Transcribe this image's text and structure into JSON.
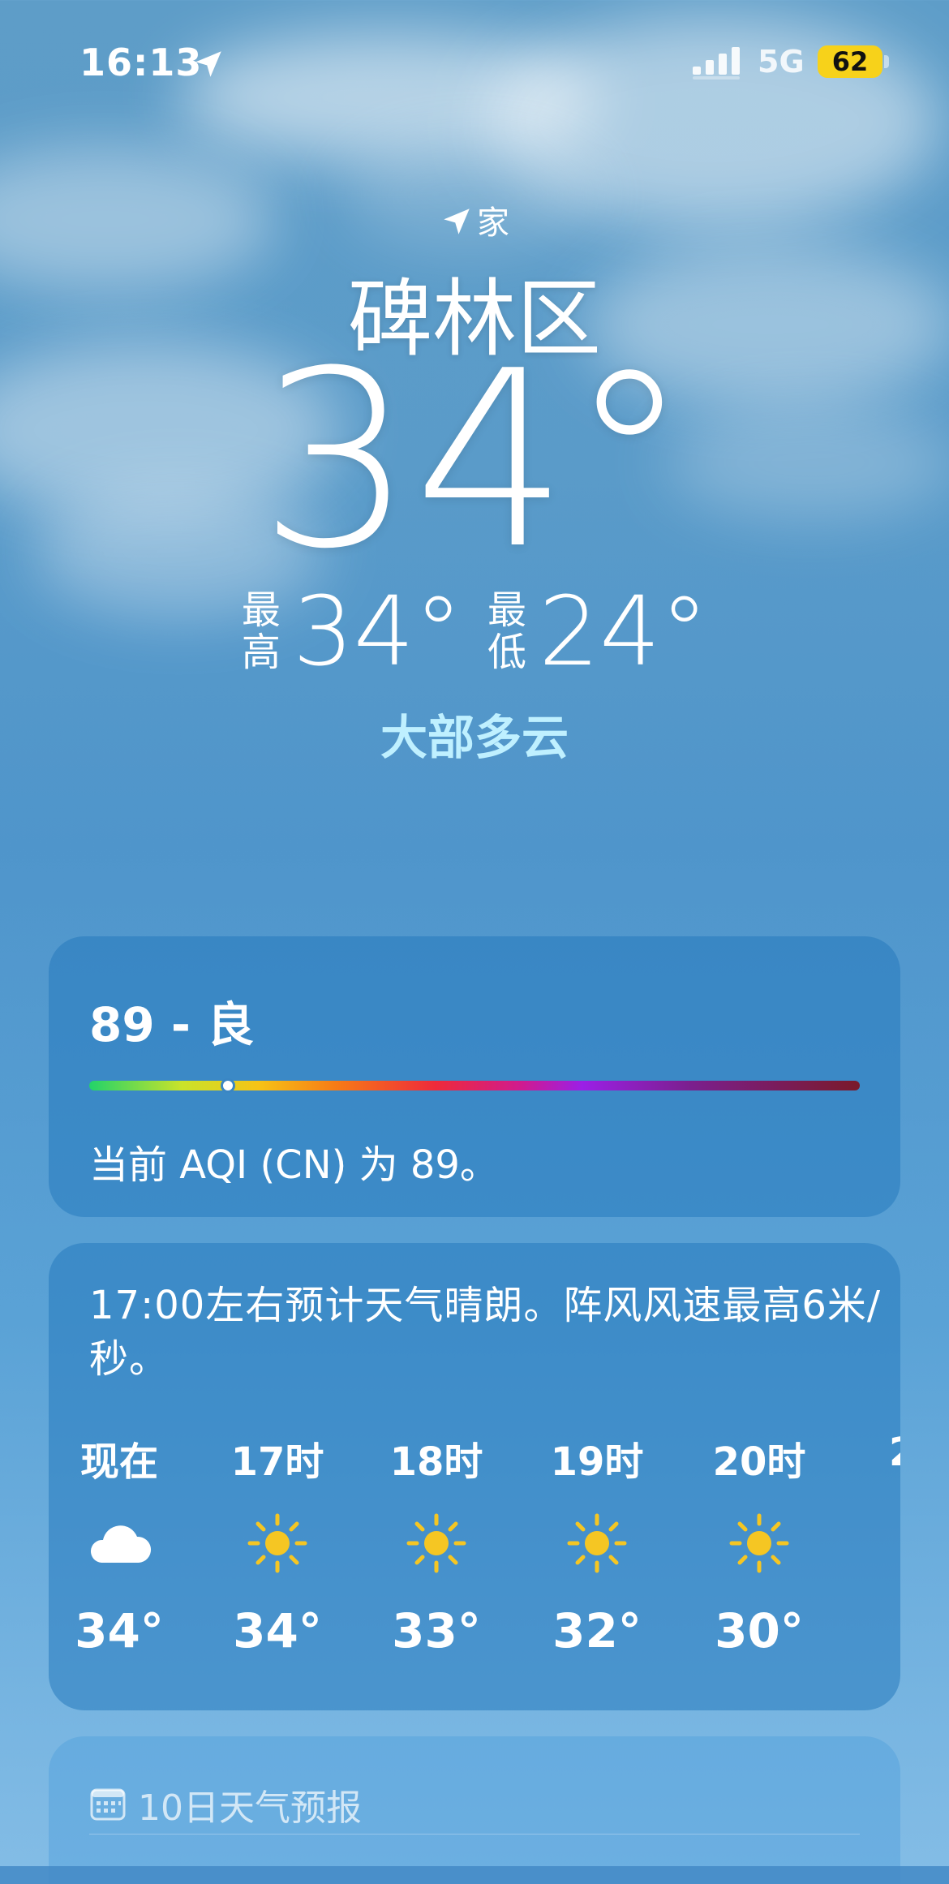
{
  "status_bar": {
    "time": "16:13",
    "network": "5G",
    "battery": "62"
  },
  "header": {
    "location_tag": "家",
    "city": "碑林区",
    "temperature": "34°",
    "high_label": "最高",
    "high_value": "34°",
    "low_label": "最低",
    "low_value": "24°",
    "condition": "大部多云"
  },
  "aqi": {
    "value_label": "89 - 良",
    "level": 0.18,
    "description": "当前 AQI (CN) 为 89。"
  },
  "hourly": {
    "summary": "17:00左右预计天气晴朗。阵风风速最高6米/秒。",
    "hours": [
      {
        "label": "现在",
        "icon": "cloud-icon",
        "temp": "34°"
      },
      {
        "label": "17时",
        "icon": "sun-icon",
        "temp": "34°"
      },
      {
        "label": "18时",
        "icon": "sun-icon",
        "temp": "33°"
      },
      {
        "label": "19时",
        "icon": "sun-icon",
        "temp": "32°"
      },
      {
        "label": "20时",
        "icon": "sun-icon",
        "temp": "30°"
      }
    ],
    "partial_label": "2"
  },
  "forecast": {
    "title": "10日天气预报"
  },
  "colors": {
    "condition_text": "#bff0ff",
    "battery": "#f7d21a",
    "sun": "#f5c623"
  }
}
